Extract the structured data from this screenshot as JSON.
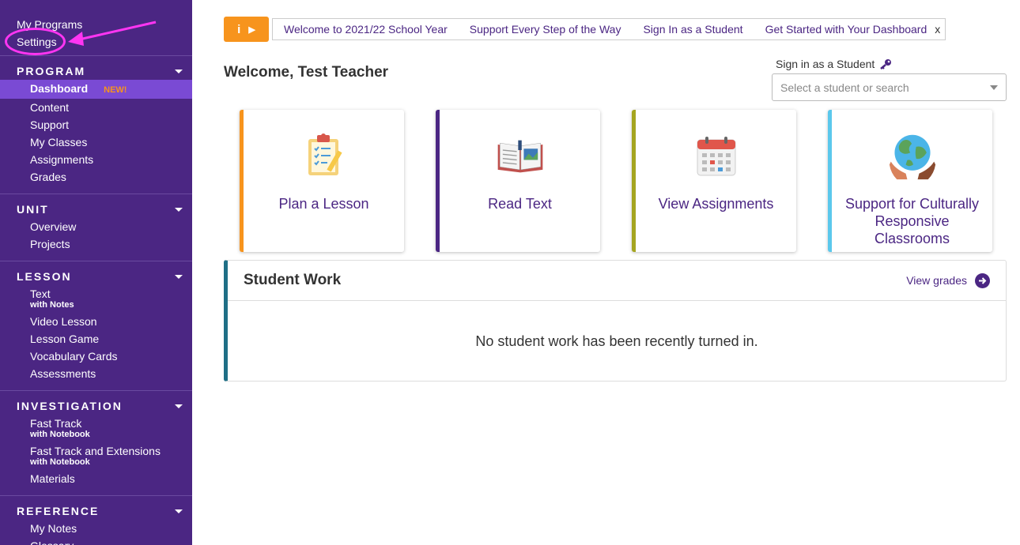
{
  "sidebar": {
    "top_links": [
      "My Programs",
      "Settings"
    ],
    "sections": [
      {
        "title": "PROGRAM",
        "items": [
          {
            "label": "Dashboard",
            "badge": "NEW!",
            "active": true
          },
          {
            "label": "Content"
          },
          {
            "label": "Support"
          },
          {
            "label": "My Classes"
          },
          {
            "label": "Assignments"
          },
          {
            "label": "Grades"
          }
        ]
      },
      {
        "title": "UNIT",
        "items": [
          {
            "label": "Overview"
          },
          {
            "label": "Projects"
          }
        ]
      },
      {
        "title": "LESSON",
        "items": [
          {
            "label": "Text",
            "sub": "with Notes"
          },
          {
            "label": "Video Lesson"
          },
          {
            "label": "Lesson Game"
          },
          {
            "label": "Vocabulary Cards"
          },
          {
            "label": "Assessments"
          }
        ]
      },
      {
        "title": "INVESTIGATION",
        "items": [
          {
            "label": "Fast Track",
            "sub": "with Notebook"
          },
          {
            "label": "Fast Track and Extensions",
            "sub": "with Notebook"
          },
          {
            "label": "Materials"
          }
        ]
      },
      {
        "title": "REFERENCE",
        "items": [
          {
            "label": "My Notes"
          },
          {
            "label": "Glossary"
          }
        ]
      }
    ]
  },
  "banner": {
    "info_icon": "i",
    "links": [
      "Welcome to 2021/22 School Year",
      "Support Every Step of the Way",
      "Sign In as a Student",
      "Get Started with Your Dashboard"
    ],
    "close": "x"
  },
  "main": {
    "welcome": "Welcome, Test Teacher",
    "signin_label": "Sign in as a Student",
    "signin_placeholder": "Select a student or search",
    "cards": [
      {
        "label": "Plan a Lesson",
        "icon": "clipboard-icon",
        "color": "#f7941d"
      },
      {
        "label": "Read Text",
        "icon": "open-book-icon",
        "color": "#4b2683"
      },
      {
        "label": "View Assignments",
        "icon": "calendar-icon",
        "color": "#a5a520"
      },
      {
        "label": "Support for Culturally Responsive Classrooms",
        "icon": "globe-hands-icon",
        "color": "#5bc8ec"
      }
    ],
    "student_work": {
      "title": "Student Work",
      "view_grades": "View grades",
      "empty_message": "No student work has been recently turned in."
    }
  },
  "colors": {
    "brand_purple": "#4b2683",
    "accent_orange": "#f7941d",
    "annotation_pink": "#ff35f2"
  }
}
